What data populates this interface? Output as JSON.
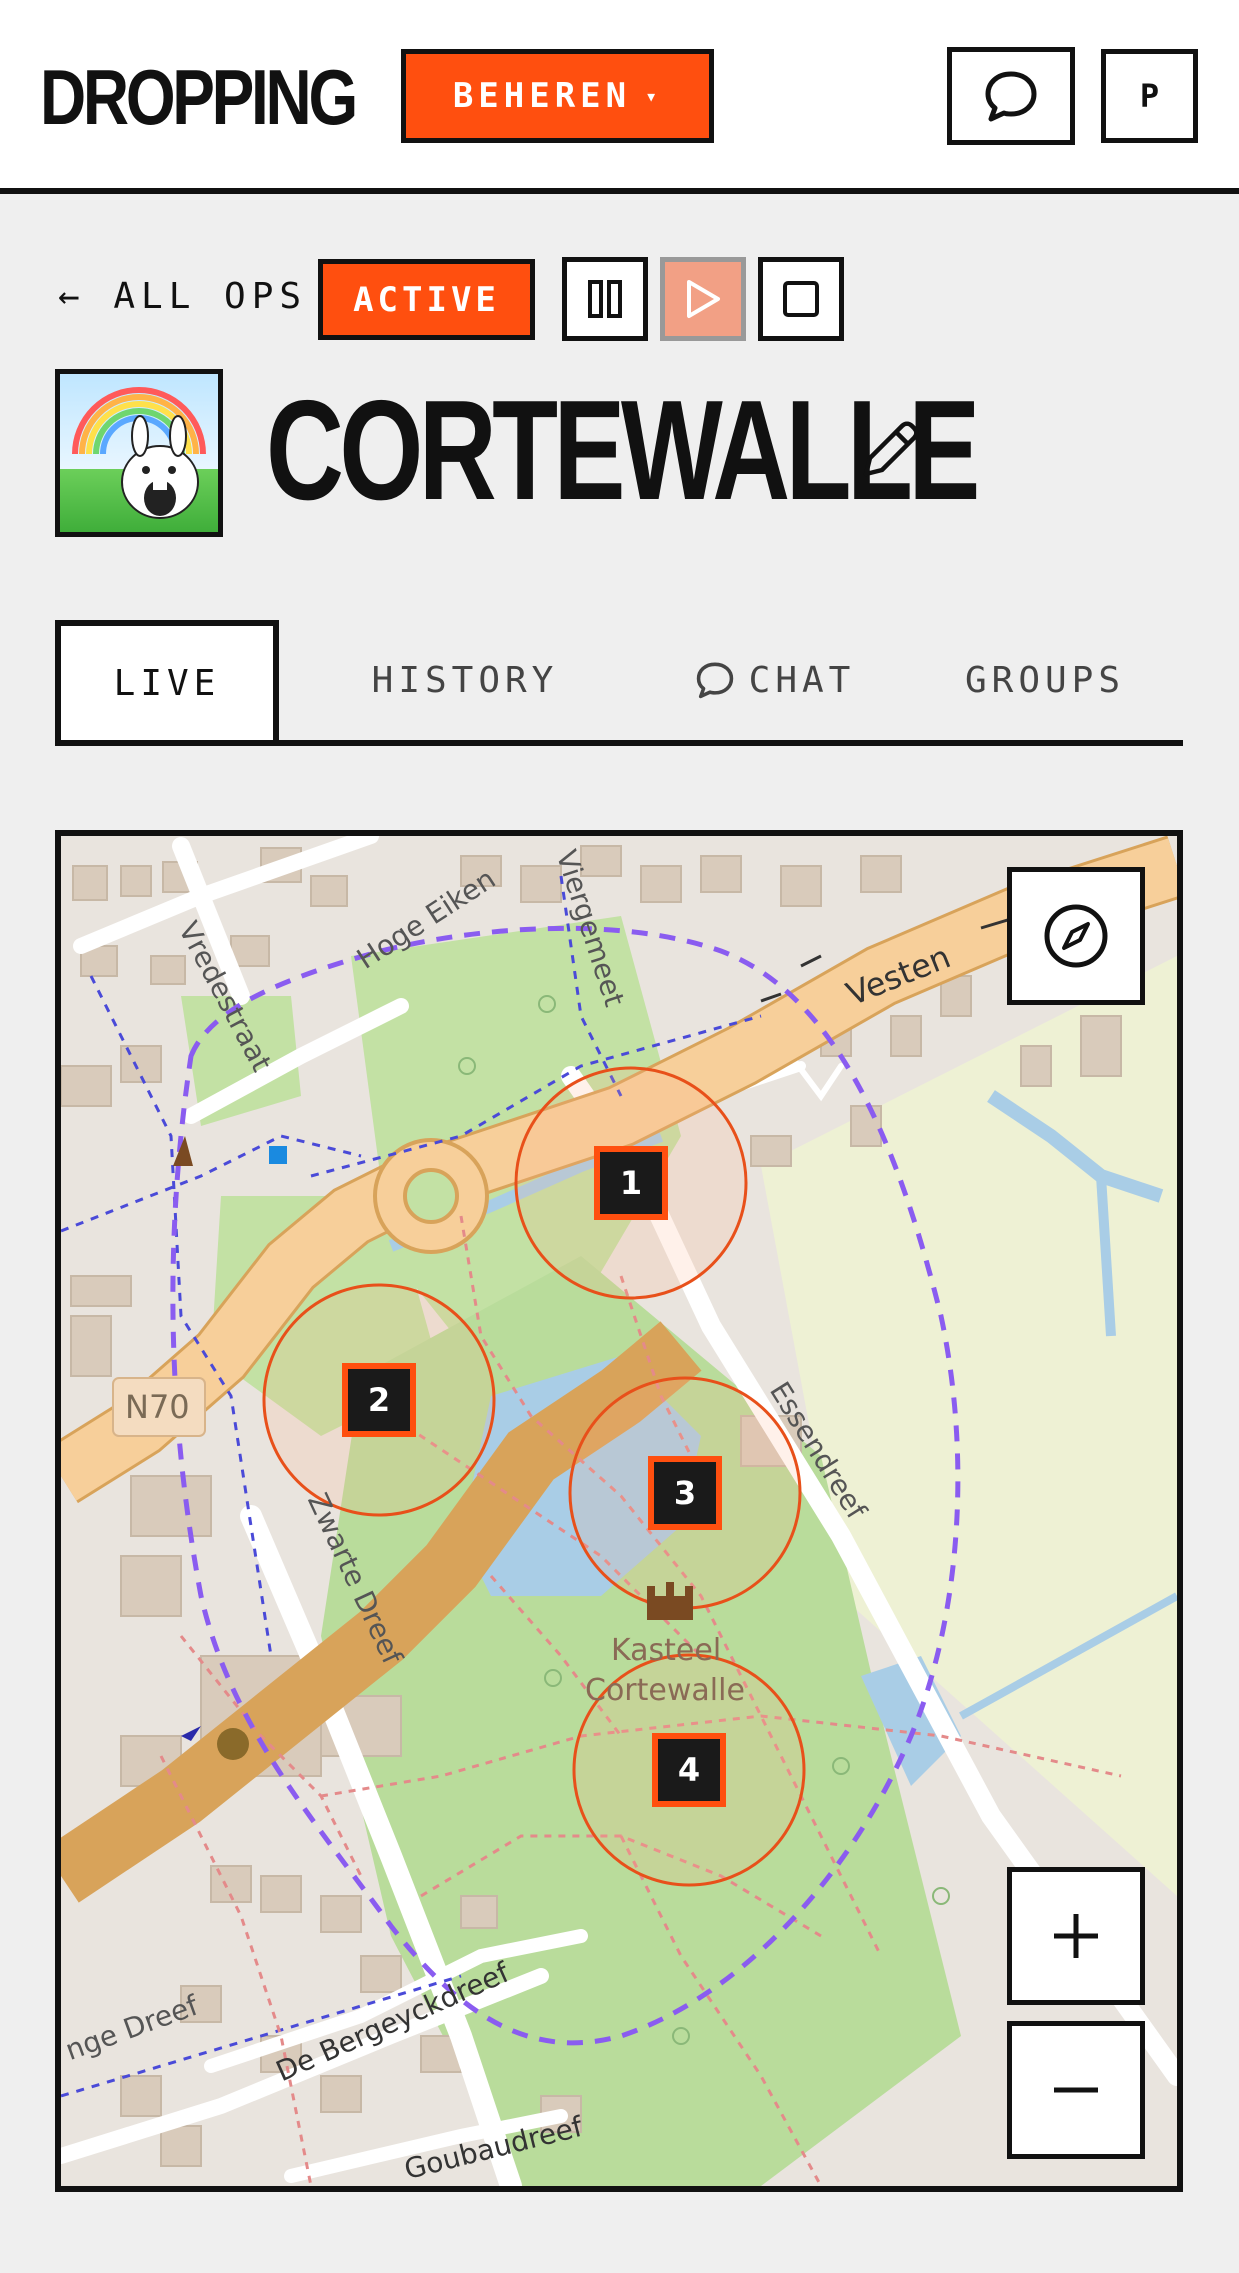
{
  "header": {
    "logo": "DROPPING",
    "manage_label": "BEHEREN",
    "manage_caret": "▾",
    "profile_initial": "P"
  },
  "op": {
    "back_label": "← ALL OPS",
    "status": "ACTIVE",
    "title": "CORTEWALLE"
  },
  "tabs": [
    {
      "label": "LIVE",
      "active": true
    },
    {
      "label": "HISTORY",
      "active": false
    },
    {
      "label": "CHAT",
      "active": false
    },
    {
      "label": "GROUPS",
      "active": false
    }
  ],
  "map": {
    "street_labels": {
      "vredestraat": "Vredestraat",
      "hoge_eiken": "Hoge Eiken",
      "viergemeet": "Viergemeet",
      "vesten": "Vesten",
      "essendreef": "Essendreef",
      "n70": "N70",
      "zwarte_dreef": "Zwarte Dreef",
      "kasteel_line1": "Kasteel",
      "kasteel_line2": "Cortewalle",
      "hoge_dreef": "nge Dreef",
      "bergeyckdreef": "De Bergeyckdreef",
      "goubaudreef": "Goubaudreef"
    },
    "markers": [
      "1",
      "2",
      "3",
      "4"
    ]
  },
  "colors": {
    "accent": "#ff4f0f",
    "ink": "#111111",
    "zone": "#8a5cf0"
  }
}
